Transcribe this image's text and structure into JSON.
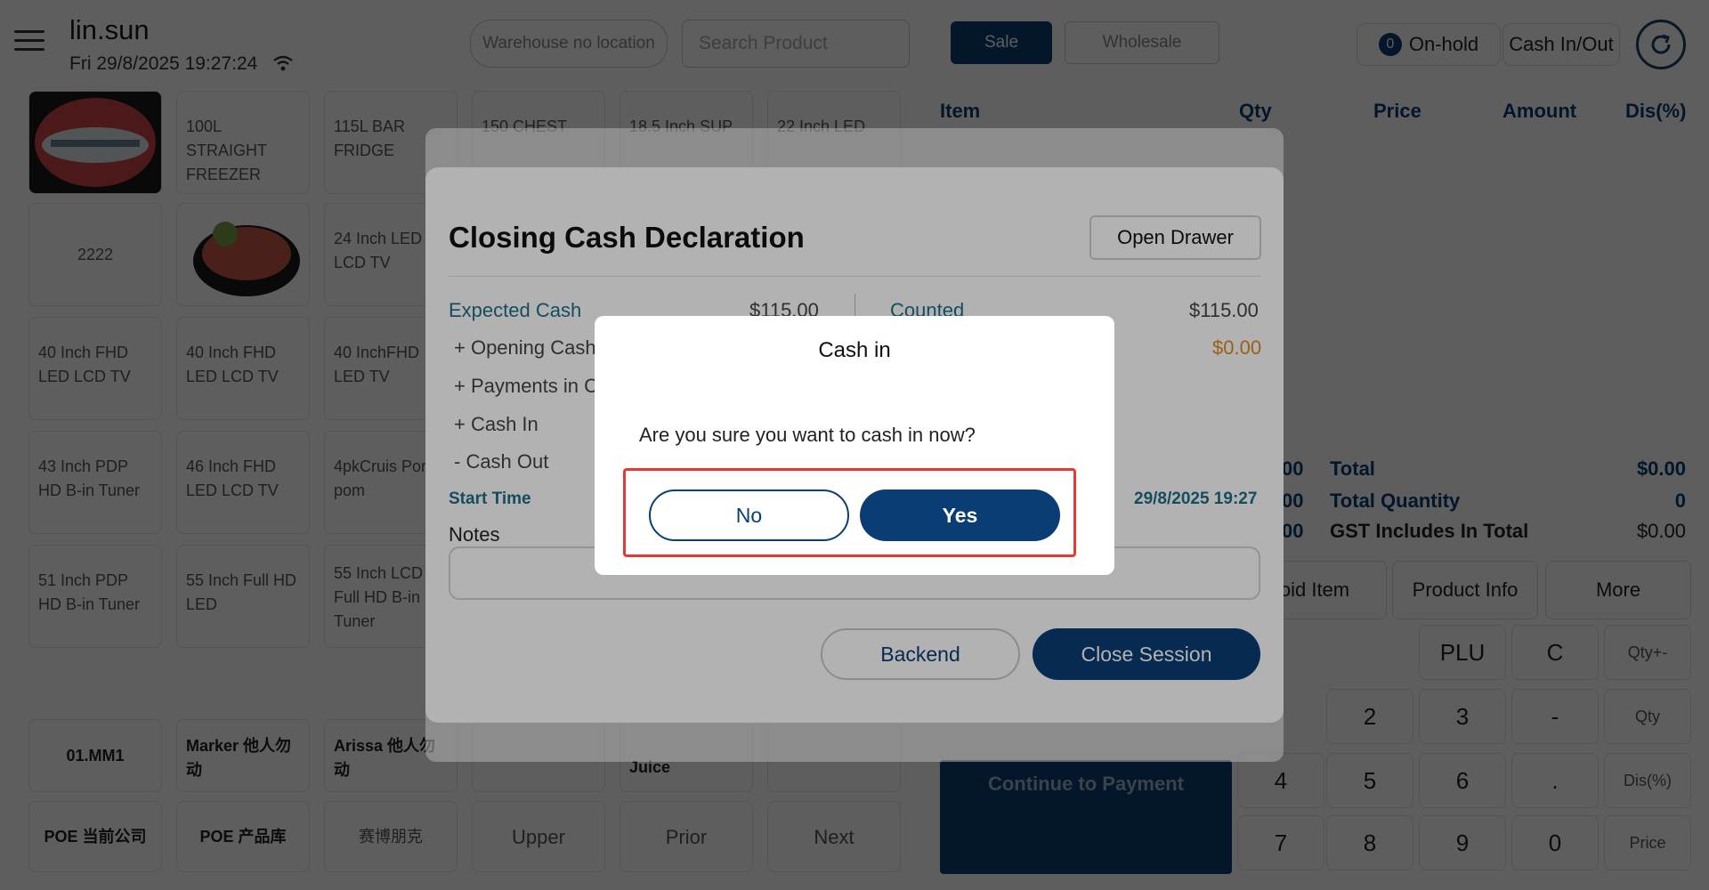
{
  "header": {
    "user_name": "lin.sun",
    "datetime": "Fri 29/8/2025 19:27:24",
    "warehouse": "Warehouse no location",
    "search_placeholder": "Search Product",
    "sale_label": "Sale",
    "wholesale_label": "Wholesale",
    "onhold_count": "0",
    "onhold_label": "On-hold",
    "cash_inout_label": "Cash In/Out"
  },
  "cart": {
    "columns": [
      "Item",
      "Qty",
      "Price",
      "Amount",
      "Dis(%)"
    ]
  },
  "products": {
    "row1": [
      "100L STRAIGHT FREEZER",
      "115L BAR FRIDGE",
      "150 CHEST",
      "18.5 Inch SUP",
      "22 Inch LED"
    ],
    "row2": [
      "2222",
      "24 Inch LED LCD TV"
    ],
    "row3": [
      "40 Inch FHD LED LCD TV",
      "40 Inch FHD LED LCD TV",
      "40 InchFHD LED TV"
    ],
    "row4": [
      "43 Inch PDP HD B-in Tuner",
      "46 Inch FHD LED LCD TV",
      "4pkCruis Por pom"
    ],
    "row5": [
      "51 Inch PDP HD B-in Tuner",
      "55 Inch Full HD LED",
      "55 Inch LCD Full HD  B-in Tuner"
    ],
    "categories": [
      "01.MM1",
      "Marker 他人勿动",
      "Arissa 他人勿动",
      "Juice"
    ],
    "bottom": [
      "POE 当前公司",
      "POE 产品库",
      "赛博朋克",
      "Upper",
      "Prior",
      "Next"
    ]
  },
  "summary": {
    "rows": [
      {
        "partial": "00",
        "label": "Total",
        "value": "$0.00"
      },
      {
        "partial": "00",
        "label": "Total Quantity",
        "value": "0"
      },
      {
        "partial": "00",
        "label": "GST Includes In Total",
        "value": "$0.00"
      }
    ],
    "buttons": [
      "oid Item",
      "Product Info",
      "More"
    ],
    "continue_label": "Continue to Payment"
  },
  "keypad": {
    "row1": [
      "PLU",
      "C",
      "Qty+-"
    ],
    "row2": [
      "2",
      "3",
      "-",
      "Qty"
    ],
    "row3": [
      "4",
      "5",
      "6",
      ".",
      "Dis(%)"
    ],
    "row4": [
      "7",
      "8",
      "9",
      "0",
      "Price"
    ]
  },
  "closing_panel": {
    "title": "Closing Cash Declaration",
    "open_drawer": "Open Drawer",
    "expected_cash_label": "Expected Cash",
    "expected_cash_value": "$115.00",
    "counted_label": "Counted",
    "counted_value": "$115.00",
    "difference_value": "$0.00",
    "opening_cash": "+ Opening Cash",
    "payments_in": "+ Payments in C",
    "cash_in": "+ Cash In",
    "cash_out": "- Cash Out",
    "start_time_label": "Start Time",
    "start_time_value": "29/8/2025 19:27",
    "notes_label": "Notes",
    "backend_label": "Backend",
    "close_session_label": "Close Session"
  },
  "dialog": {
    "title": "Cash in",
    "message": "Are you sure you want to cash in now?",
    "no_label": "No",
    "yes_label": "Yes"
  },
  "colors": {
    "primary": "#0a3d73",
    "teal": "#1f6f87",
    "warning": "#e08a1e",
    "highlight": "#e53935"
  }
}
